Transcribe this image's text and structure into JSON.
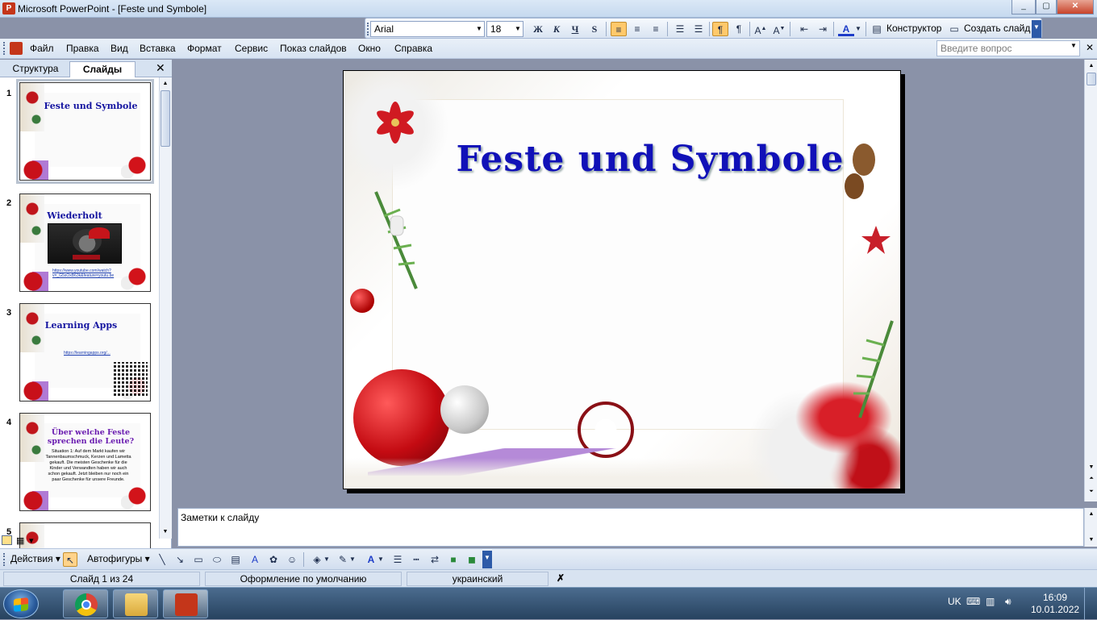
{
  "window": {
    "title": "Microsoft PowerPoint - [Feste und Symbole]",
    "app_icon": "powerpoint-icon",
    "min": "_",
    "max": "▢",
    "close": "✕"
  },
  "format_toolbar": {
    "font": "Arial",
    "size": "18",
    "bold": "Ж",
    "italic": "К",
    "underline": "Ч",
    "shadow": "S",
    "designer": "Конструктор",
    "new_slide": "Создать слайд"
  },
  "menu": [
    "Файл",
    "Правка",
    "Вид",
    "Вставка",
    "Формат",
    "Сервис",
    "Показ слайдов",
    "Окно",
    "Справка"
  ],
  "help_placeholder": "Введите вопрос",
  "left_pane": {
    "tabs": [
      "Структура",
      "Слайды"
    ],
    "close": "✕",
    "slides": [
      {
        "num": "1",
        "title": "Feste und Symbole"
      },
      {
        "num": "2",
        "title": "Wiederholt",
        "link": "https://www.youtube.com/watch?v=_G5sOxB63k&feature=youtu.be"
      },
      {
        "num": "3",
        "title": "Learning Apps",
        "link": "https://learningapps.org/..."
      },
      {
        "num": "4",
        "title": "Über welche Feste sprechen die Leute?",
        "body": "Situation 1: Auf dem Markt kaufen wir Tannenbaumschmuck, Kerzen und Lametta gekauft. Die meisten Geschenke für die Kinder und Verwandten haben wir auch schon gekauft. Jetzt bleiben nur noch ein paar Geschenke für unsere Freunde."
      },
      {
        "num": "5"
      }
    ]
  },
  "slide": {
    "title": "Feste und Symbole"
  },
  "notes": "Заметки к слайду",
  "draw_toolbar": {
    "actions": "Действия",
    "autoshapes": "Автофигуры"
  },
  "status": {
    "slide_of": "Слайд 1 из 24",
    "design": "Оформление по умолчанию",
    "language": "украинский"
  },
  "taskbar": {
    "lang": "UK",
    "time": "16:09",
    "date": "10.01.2022"
  },
  "colors": {
    "title_blue": "#1111b8",
    "accent_orange": "#ffc96b"
  }
}
